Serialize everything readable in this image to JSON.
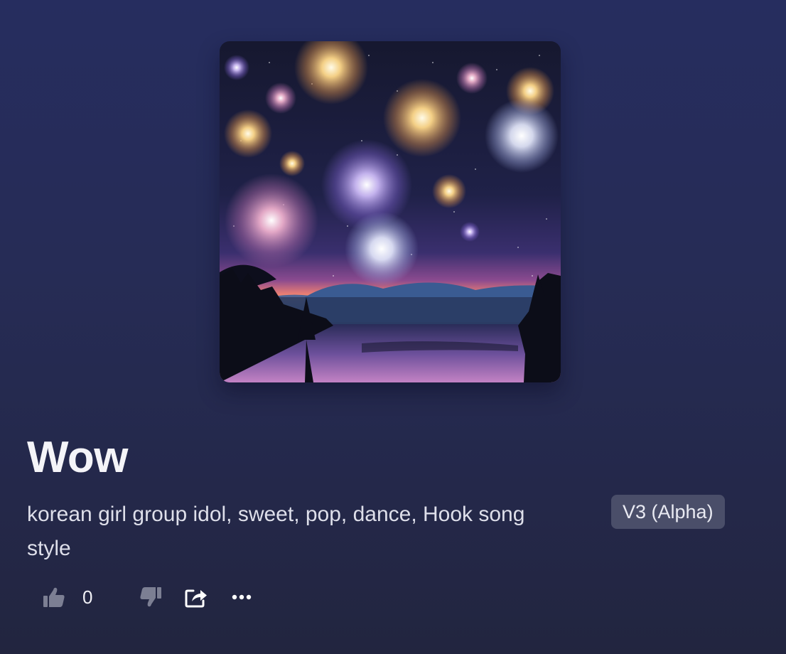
{
  "song": {
    "title": "Wow",
    "tags": "korean girl group idol, sweet, pop, dance, Hook song style",
    "model_badge": "V3 (Alpha)",
    "cover_art": "fireworks-over-lake-night-scene"
  },
  "actions": {
    "like_count": "0",
    "like_icon": "thumbs-up-icon",
    "dislike_icon": "thumbs-down-icon",
    "share_icon": "share-icon",
    "more_icon": "more-options-icon"
  },
  "colors": {
    "background_top": "#262d5f",
    "background_bottom": "#22253f",
    "badge_bg": "#4a4e69",
    "icon_muted": "#7c7f93",
    "icon_bright": "#ffffff"
  }
}
